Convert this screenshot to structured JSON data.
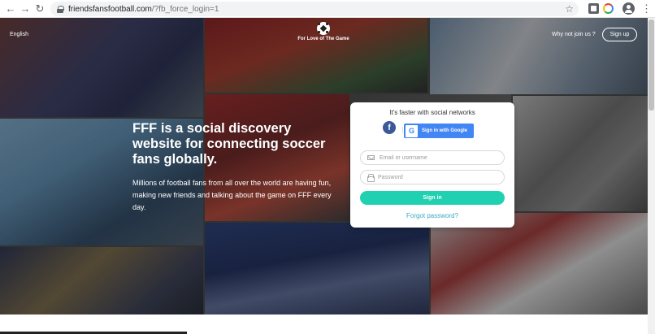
{
  "browser": {
    "url_domain": "friendsfansfootball.com",
    "url_path": "/?fb_force_login=1",
    "back_icon": "arrow-left",
    "forward_icon": "arrow-right",
    "reload_icon": "reload",
    "star_icon": "star-outline",
    "menu_icon": "vertical-dots"
  },
  "header": {
    "language": "English",
    "logo_text": "For Love of The Game",
    "why_join": "Why not join us ?",
    "signup_label": "Sign up"
  },
  "hero": {
    "headline": "FFF is a social discovery website for connecting soccer fans globally.",
    "subcopy": "Millions of football fans from all over the world are having fun, making new friends and talking about the game on FFF every day."
  },
  "login": {
    "title": "It's faster with social networks",
    "facebook_letter": "f",
    "google_letter": "G",
    "google_label": "Sign in with Google",
    "email_placeholder": "Email or username",
    "password_placeholder": "Password",
    "signin_label": "Sign in",
    "forgot_label": "Forgot password?"
  },
  "colors": {
    "accent_teal": "#1fd1b0",
    "link_blue": "#3aa7c9",
    "facebook_blue": "#3b5998",
    "google_blue": "#4285f4"
  }
}
